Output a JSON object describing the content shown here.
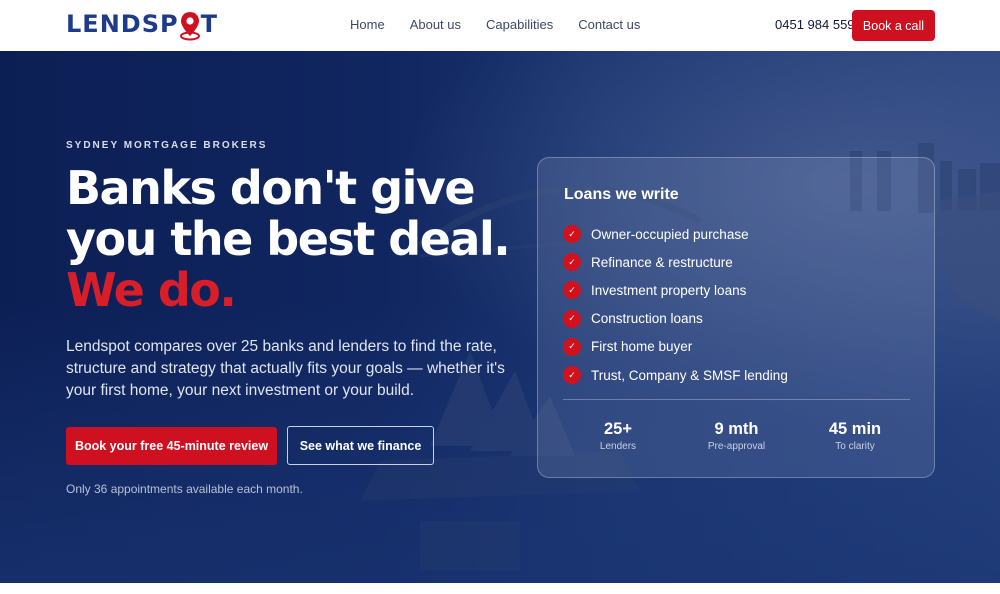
{
  "brand": {
    "logo_text_left": "LENDSP",
    "logo_text_right": "T",
    "logo_icon": "map-pin-icon",
    "colors": {
      "navy": "#1d3b8a",
      "red": "#cf1020",
      "hero_bg": "#0c1f55"
    }
  },
  "nav": {
    "items": [
      {
        "label": "Home"
      },
      {
        "label": "About us"
      },
      {
        "label": "Capabilities"
      },
      {
        "label": "Contact us"
      }
    ],
    "phone": "0451 984 559",
    "cta_label": "Book a call"
  },
  "hero": {
    "eyebrow": "SYDNEY MORTGAGE BROKERS",
    "headline_line1": "Banks don't give",
    "headline_line2": "you the best deal.",
    "headline_accent": "We do.",
    "lead": "Lendspot compares over 25 banks and lenders to find the rate, structure and strategy that actually fits your goals — whether it's your first home, your next investment or your build.",
    "primary_cta": "Book your free 45-minute review",
    "secondary_cta": "See what we finance",
    "note": "Only 36 appointments available each month."
  },
  "card": {
    "title": "Loans we write",
    "check_icon": "check-icon",
    "items": [
      {
        "label": "Owner-occupied purchase"
      },
      {
        "label": "Refinance & restructure"
      },
      {
        "label": "Investment property loans"
      },
      {
        "label": "Construction loans"
      },
      {
        "label": "First home buyer"
      },
      {
        "label": "Trust, Company & SMSF lending"
      }
    ],
    "stats": [
      {
        "value": "25+",
        "label": "Lenders"
      },
      {
        "value": "9 mth",
        "label": "Pre-approval"
      },
      {
        "value": "45 min",
        "label": "To clarity"
      }
    ]
  }
}
